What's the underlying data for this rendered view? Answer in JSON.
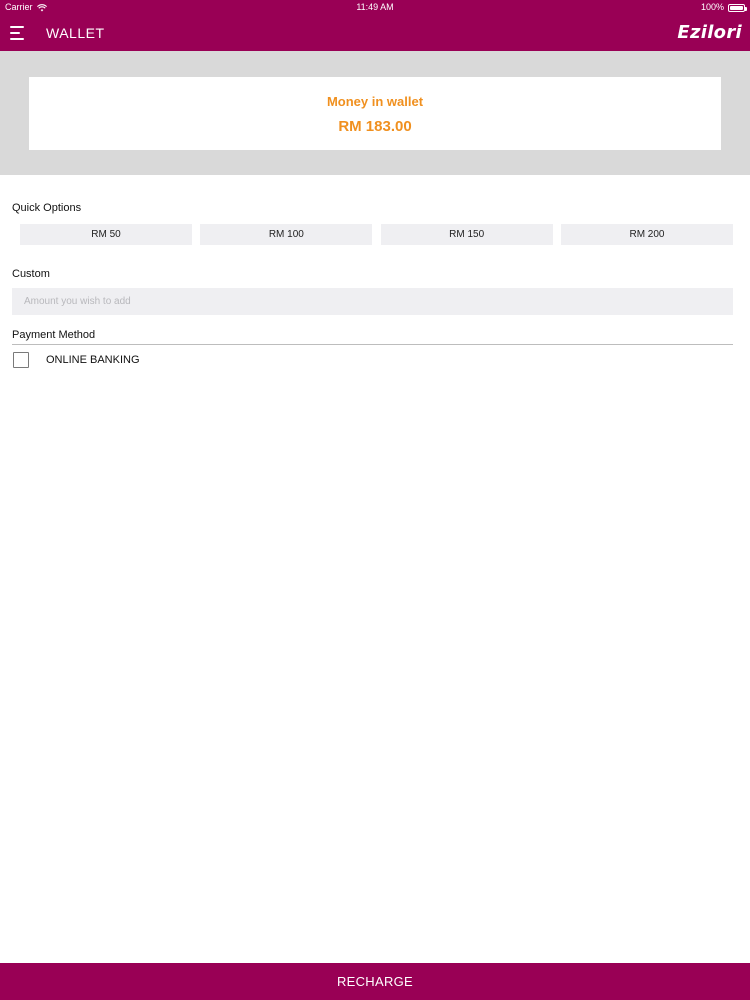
{
  "status_bar": {
    "carrier": "Carrier",
    "time": "11:49 AM",
    "battery": "100%"
  },
  "header": {
    "title": "WALLET",
    "brand": "Ezilori"
  },
  "wallet": {
    "label": "Money in wallet",
    "amount": "RM 183.00"
  },
  "quick_options": {
    "label": "Quick Options",
    "items": [
      {
        "label": "RM 50"
      },
      {
        "label": "RM 100"
      },
      {
        "label": "RM 150"
      },
      {
        "label": "RM 200"
      }
    ]
  },
  "custom": {
    "label": "Custom",
    "placeholder": "Amount you wish to add",
    "value": ""
  },
  "payment": {
    "label": "Payment Method",
    "methods": [
      {
        "label": "ONLINE BANKING",
        "checked": false
      }
    ]
  },
  "footer": {
    "recharge_label": "RECHARGE"
  },
  "colors": {
    "brand": "#990055",
    "accent": "#f0901f",
    "band": "#d9d9d9",
    "field": "#efeff2"
  },
  "icons": {
    "menu": "hamburger-icon",
    "wifi": "wifi-icon",
    "battery": "battery-icon",
    "checkbox": "checkbox-icon"
  }
}
